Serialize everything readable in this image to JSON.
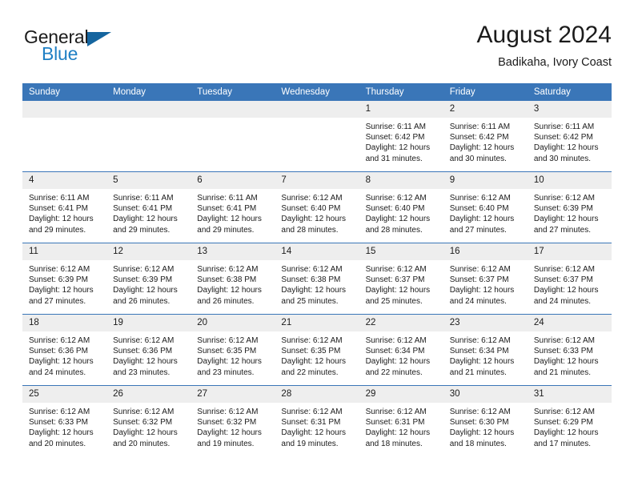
{
  "brand": {
    "name_part1": "General",
    "name_part2": "Blue",
    "accent_color": "#1f7fc4",
    "triangle_color": "#15659f"
  },
  "header": {
    "title": "August 2024",
    "subtitle": "Badikaha, Ivory Coast"
  },
  "calendar": {
    "header_bg": "#3a76b8",
    "daynum_bg": "#eeeeee",
    "weekday_headers": [
      "Sunday",
      "Monday",
      "Tuesday",
      "Wednesday",
      "Thursday",
      "Friday",
      "Saturday"
    ],
    "weeks": [
      [
        {
          "day": "",
          "sunrise": "",
          "sunset": "",
          "daylight_line1": "",
          "daylight_line2": ""
        },
        {
          "day": "",
          "sunrise": "",
          "sunset": "",
          "daylight_line1": "",
          "daylight_line2": ""
        },
        {
          "day": "",
          "sunrise": "",
          "sunset": "",
          "daylight_line1": "",
          "daylight_line2": ""
        },
        {
          "day": "",
          "sunrise": "",
          "sunset": "",
          "daylight_line1": "",
          "daylight_line2": ""
        },
        {
          "day": "1",
          "sunrise": "Sunrise: 6:11 AM",
          "sunset": "Sunset: 6:42 PM",
          "daylight_line1": "Daylight: 12 hours",
          "daylight_line2": "and 31 minutes."
        },
        {
          "day": "2",
          "sunrise": "Sunrise: 6:11 AM",
          "sunset": "Sunset: 6:42 PM",
          "daylight_line1": "Daylight: 12 hours",
          "daylight_line2": "and 30 minutes."
        },
        {
          "day": "3",
          "sunrise": "Sunrise: 6:11 AM",
          "sunset": "Sunset: 6:42 PM",
          "daylight_line1": "Daylight: 12 hours",
          "daylight_line2": "and 30 minutes."
        }
      ],
      [
        {
          "day": "4",
          "sunrise": "Sunrise: 6:11 AM",
          "sunset": "Sunset: 6:41 PM",
          "daylight_line1": "Daylight: 12 hours",
          "daylight_line2": "and 29 minutes."
        },
        {
          "day": "5",
          "sunrise": "Sunrise: 6:11 AM",
          "sunset": "Sunset: 6:41 PM",
          "daylight_line1": "Daylight: 12 hours",
          "daylight_line2": "and 29 minutes."
        },
        {
          "day": "6",
          "sunrise": "Sunrise: 6:11 AM",
          "sunset": "Sunset: 6:41 PM",
          "daylight_line1": "Daylight: 12 hours",
          "daylight_line2": "and 29 minutes."
        },
        {
          "day": "7",
          "sunrise": "Sunrise: 6:12 AM",
          "sunset": "Sunset: 6:40 PM",
          "daylight_line1": "Daylight: 12 hours",
          "daylight_line2": "and 28 minutes."
        },
        {
          "day": "8",
          "sunrise": "Sunrise: 6:12 AM",
          "sunset": "Sunset: 6:40 PM",
          "daylight_line1": "Daylight: 12 hours",
          "daylight_line2": "and 28 minutes."
        },
        {
          "day": "9",
          "sunrise": "Sunrise: 6:12 AM",
          "sunset": "Sunset: 6:40 PM",
          "daylight_line1": "Daylight: 12 hours",
          "daylight_line2": "and 27 minutes."
        },
        {
          "day": "10",
          "sunrise": "Sunrise: 6:12 AM",
          "sunset": "Sunset: 6:39 PM",
          "daylight_line1": "Daylight: 12 hours",
          "daylight_line2": "and 27 minutes."
        }
      ],
      [
        {
          "day": "11",
          "sunrise": "Sunrise: 6:12 AM",
          "sunset": "Sunset: 6:39 PM",
          "daylight_line1": "Daylight: 12 hours",
          "daylight_line2": "and 27 minutes."
        },
        {
          "day": "12",
          "sunrise": "Sunrise: 6:12 AM",
          "sunset": "Sunset: 6:39 PM",
          "daylight_line1": "Daylight: 12 hours",
          "daylight_line2": "and 26 minutes."
        },
        {
          "day": "13",
          "sunrise": "Sunrise: 6:12 AM",
          "sunset": "Sunset: 6:38 PM",
          "daylight_line1": "Daylight: 12 hours",
          "daylight_line2": "and 26 minutes."
        },
        {
          "day": "14",
          "sunrise": "Sunrise: 6:12 AM",
          "sunset": "Sunset: 6:38 PM",
          "daylight_line1": "Daylight: 12 hours",
          "daylight_line2": "and 25 minutes."
        },
        {
          "day": "15",
          "sunrise": "Sunrise: 6:12 AM",
          "sunset": "Sunset: 6:37 PM",
          "daylight_line1": "Daylight: 12 hours",
          "daylight_line2": "and 25 minutes."
        },
        {
          "day": "16",
          "sunrise": "Sunrise: 6:12 AM",
          "sunset": "Sunset: 6:37 PM",
          "daylight_line1": "Daylight: 12 hours",
          "daylight_line2": "and 24 minutes."
        },
        {
          "day": "17",
          "sunrise": "Sunrise: 6:12 AM",
          "sunset": "Sunset: 6:37 PM",
          "daylight_line1": "Daylight: 12 hours",
          "daylight_line2": "and 24 minutes."
        }
      ],
      [
        {
          "day": "18",
          "sunrise": "Sunrise: 6:12 AM",
          "sunset": "Sunset: 6:36 PM",
          "daylight_line1": "Daylight: 12 hours",
          "daylight_line2": "and 24 minutes."
        },
        {
          "day": "19",
          "sunrise": "Sunrise: 6:12 AM",
          "sunset": "Sunset: 6:36 PM",
          "daylight_line1": "Daylight: 12 hours",
          "daylight_line2": "and 23 minutes."
        },
        {
          "day": "20",
          "sunrise": "Sunrise: 6:12 AM",
          "sunset": "Sunset: 6:35 PM",
          "daylight_line1": "Daylight: 12 hours",
          "daylight_line2": "and 23 minutes."
        },
        {
          "day": "21",
          "sunrise": "Sunrise: 6:12 AM",
          "sunset": "Sunset: 6:35 PM",
          "daylight_line1": "Daylight: 12 hours",
          "daylight_line2": "and 22 minutes."
        },
        {
          "day": "22",
          "sunrise": "Sunrise: 6:12 AM",
          "sunset": "Sunset: 6:34 PM",
          "daylight_line1": "Daylight: 12 hours",
          "daylight_line2": "and 22 minutes."
        },
        {
          "day": "23",
          "sunrise": "Sunrise: 6:12 AM",
          "sunset": "Sunset: 6:34 PM",
          "daylight_line1": "Daylight: 12 hours",
          "daylight_line2": "and 21 minutes."
        },
        {
          "day": "24",
          "sunrise": "Sunrise: 6:12 AM",
          "sunset": "Sunset: 6:33 PM",
          "daylight_line1": "Daylight: 12 hours",
          "daylight_line2": "and 21 minutes."
        }
      ],
      [
        {
          "day": "25",
          "sunrise": "Sunrise: 6:12 AM",
          "sunset": "Sunset: 6:33 PM",
          "daylight_line1": "Daylight: 12 hours",
          "daylight_line2": "and 20 minutes."
        },
        {
          "day": "26",
          "sunrise": "Sunrise: 6:12 AM",
          "sunset": "Sunset: 6:32 PM",
          "daylight_line1": "Daylight: 12 hours",
          "daylight_line2": "and 20 minutes."
        },
        {
          "day": "27",
          "sunrise": "Sunrise: 6:12 AM",
          "sunset": "Sunset: 6:32 PM",
          "daylight_line1": "Daylight: 12 hours",
          "daylight_line2": "and 19 minutes."
        },
        {
          "day": "28",
          "sunrise": "Sunrise: 6:12 AM",
          "sunset": "Sunset: 6:31 PM",
          "daylight_line1": "Daylight: 12 hours",
          "daylight_line2": "and 19 minutes."
        },
        {
          "day": "29",
          "sunrise": "Sunrise: 6:12 AM",
          "sunset": "Sunset: 6:31 PM",
          "daylight_line1": "Daylight: 12 hours",
          "daylight_line2": "and 18 minutes."
        },
        {
          "day": "30",
          "sunrise": "Sunrise: 6:12 AM",
          "sunset": "Sunset: 6:30 PM",
          "daylight_line1": "Daylight: 12 hours",
          "daylight_line2": "and 18 minutes."
        },
        {
          "day": "31",
          "sunrise": "Sunrise: 6:12 AM",
          "sunset": "Sunset: 6:29 PM",
          "daylight_line1": "Daylight: 12 hours",
          "daylight_line2": "and 17 minutes."
        }
      ]
    ]
  }
}
